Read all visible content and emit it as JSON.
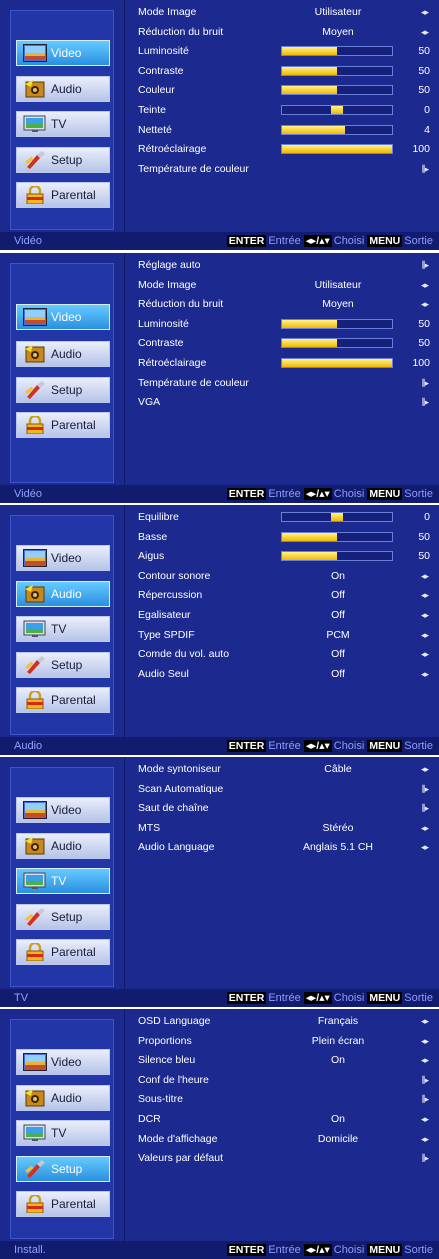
{
  "colors": {
    "panel": "#1c2a90",
    "active_button": "#2a8fe0",
    "bar_fill": "#f2b800",
    "status_bar": "#121c6e"
  },
  "icons": {
    "lr_arrow": "◂▸",
    "enter_arrow": "⫼▸",
    "nav_glyph": "◂▸/▴▾"
  },
  "status_help": {
    "enter_key": "ENTER",
    "enter_text": "Entrée",
    "choose_text": "Choisi",
    "menu_key": "MENU",
    "menu_text": "Sortie"
  },
  "screens": [
    {
      "title": "Vidéo",
      "menu": [
        {
          "label": "Video",
          "icon": "video-icon",
          "active": true
        },
        {
          "label": "Audio",
          "icon": "audio-icon",
          "active": false
        },
        {
          "label": "TV",
          "icon": "tv-icon",
          "active": false
        },
        {
          "label": "Setup",
          "icon": "setup-icon",
          "active": false
        },
        {
          "label": "Parental",
          "icon": "parental-icon",
          "active": false
        }
      ],
      "rows": [
        {
          "label": "Mode Image",
          "kind": "value",
          "value": "Utilisateur"
        },
        {
          "label": "Réduction du bruit",
          "kind": "value",
          "value": "Moyen"
        },
        {
          "label": "Luminosité",
          "kind": "bar",
          "value": "50",
          "level": 0.5
        },
        {
          "label": "Contraste",
          "kind": "bar",
          "value": "50",
          "level": 0.5
        },
        {
          "label": "Couleur",
          "kind": "bar",
          "value": "50",
          "level": 0.5
        },
        {
          "label": "Teinte",
          "kind": "center",
          "value": "0",
          "level": 0.5
        },
        {
          "label": "Netteté",
          "kind": "bar",
          "value": "4",
          "level": 0.57
        },
        {
          "label": "Rétroéclairage",
          "kind": "bar",
          "value": "100",
          "level": 1.0
        },
        {
          "label": "Température de couleur",
          "kind": "enter"
        }
      ]
    },
    {
      "title": "Vidéo",
      "menu": [
        {
          "label": "Video",
          "icon": "video-icon",
          "active": true
        },
        {
          "label": "Audio",
          "icon": "audio-icon",
          "active": false
        },
        {
          "label": "Setup",
          "icon": "setup-icon",
          "active": false
        },
        {
          "label": "Parental",
          "icon": "parental-icon",
          "active": false
        }
      ],
      "rows": [
        {
          "label": "Réglage auto",
          "kind": "enter"
        },
        {
          "label": "Mode Image",
          "kind": "value",
          "value": "Utilisateur"
        },
        {
          "label": "Réduction du bruit",
          "kind": "value",
          "value": "Moyen"
        },
        {
          "label": "Luminosité",
          "kind": "bar",
          "value": "50",
          "level": 0.5
        },
        {
          "label": "Contraste",
          "kind": "bar",
          "value": "50",
          "level": 0.5
        },
        {
          "label": "Rétroéclairage",
          "kind": "bar",
          "value": "100",
          "level": 1.0
        },
        {
          "label": "Température de couleur",
          "kind": "enter"
        },
        {
          "label": "VGA",
          "kind": "enter"
        }
      ]
    },
    {
      "title": "Audio",
      "menu": [
        {
          "label": "Video",
          "icon": "video-icon",
          "active": false
        },
        {
          "label": "Audio",
          "icon": "audio-icon",
          "active": true
        },
        {
          "label": "TV",
          "icon": "tv-icon",
          "active": false
        },
        {
          "label": "Setup",
          "icon": "setup-icon",
          "active": false
        },
        {
          "label": "Parental",
          "icon": "parental-icon",
          "active": false
        }
      ],
      "rows": [
        {
          "label": "Equilibre",
          "kind": "center",
          "value": "0",
          "level": 0.5
        },
        {
          "label": "Basse",
          "kind": "bar",
          "value": "50",
          "level": 0.5
        },
        {
          "label": "Aigus",
          "kind": "bar",
          "value": "50",
          "level": 0.5
        },
        {
          "label": "Contour sonore",
          "kind": "value",
          "value": "On"
        },
        {
          "label": "Répercussion",
          "kind": "value",
          "value": "Off"
        },
        {
          "label": "Egalisateur",
          "kind": "value",
          "value": "Off"
        },
        {
          "label": "Type SPDIF",
          "kind": "value",
          "value": "PCM"
        },
        {
          "label": "Comde du vol. auto",
          "kind": "value",
          "value": "Off"
        },
        {
          "label": "Audio Seul",
          "kind": "value",
          "value": "Off"
        }
      ]
    },
    {
      "title": "TV",
      "menu": [
        {
          "label": "Video",
          "icon": "video-icon",
          "active": false
        },
        {
          "label": "Audio",
          "icon": "audio-icon",
          "active": false
        },
        {
          "label": "TV",
          "icon": "tv-icon",
          "active": true
        },
        {
          "label": "Setup",
          "icon": "setup-icon",
          "active": false
        },
        {
          "label": "Parental",
          "icon": "parental-icon",
          "active": false
        }
      ],
      "rows": [
        {
          "label": "Mode syntoniseur",
          "kind": "value",
          "value": "Câble"
        },
        {
          "label": "Scan Automatique",
          "kind": "enter"
        },
        {
          "label": "Saut de chaîne",
          "kind": "enter"
        },
        {
          "label": "MTS",
          "kind": "value",
          "value": "Stéréo"
        },
        {
          "label": "Audio Language",
          "kind": "value",
          "value": "Anglais 5.1 CH"
        }
      ]
    },
    {
      "title": "Install.",
      "menu": [
        {
          "label": "Video",
          "icon": "video-icon",
          "active": false
        },
        {
          "label": "Audio",
          "icon": "audio-icon",
          "active": false
        },
        {
          "label": "TV",
          "icon": "tv-icon",
          "active": false
        },
        {
          "label": "Setup",
          "icon": "setup-icon",
          "active": true
        },
        {
          "label": "Parental",
          "icon": "parental-icon",
          "active": false
        }
      ],
      "rows": [
        {
          "label": "OSD Language",
          "kind": "value",
          "value": "Français"
        },
        {
          "label": "Proportions",
          "kind": "value",
          "value": "Plein écran"
        },
        {
          "label": "Silence bleu",
          "kind": "value",
          "value": "On"
        },
        {
          "label": "Conf de l'heure",
          "kind": "enter"
        },
        {
          "label": "Sous-titre",
          "kind": "enter"
        },
        {
          "label": "DCR",
          "kind": "value",
          "value": "On"
        },
        {
          "label": "Mode d'affichage",
          "kind": "value",
          "value": "Domicile"
        },
        {
          "label": "Valeurs par défaut",
          "kind": "enter"
        }
      ]
    }
  ]
}
